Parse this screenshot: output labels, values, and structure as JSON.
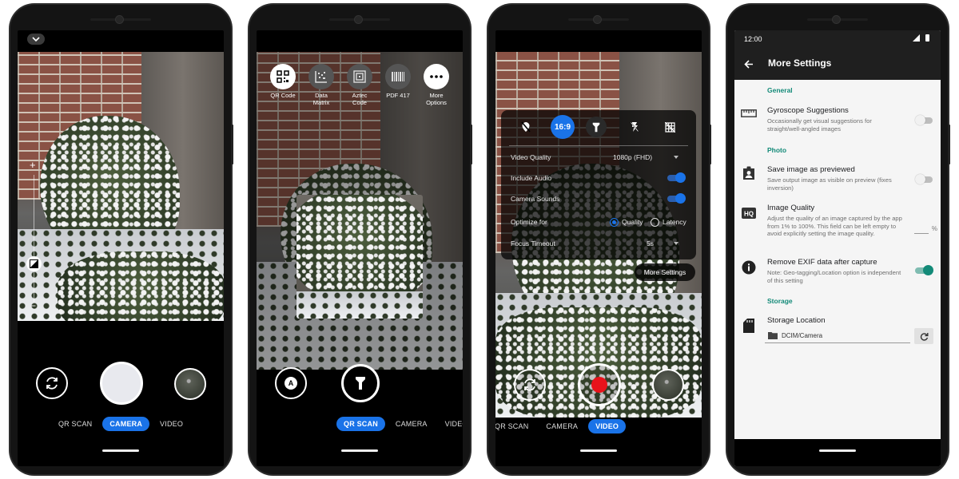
{
  "phone1": {
    "modes": [
      "QR SCAN",
      "CAMERA",
      "VIDEO"
    ],
    "active_mode": "CAMERA",
    "zoom_plus": "+",
    "zoom_minus": "−"
  },
  "phone2": {
    "barcode_types": [
      {
        "label": "QR Code"
      },
      {
        "label": "Data Matrix"
      },
      {
        "label": "Aztec Code"
      },
      {
        "label": "PDF 417"
      },
      {
        "label": "More Options"
      }
    ],
    "modes": [
      "QR SCAN",
      "CAMERA",
      "VIDEO"
    ],
    "auto_label": "A"
  },
  "phone3": {
    "aspect_ratio": "16:9",
    "settings": {
      "video_quality_label": "Video Quality",
      "video_quality_value": "1080p (FHD)",
      "include_audio_label": "Include Audio",
      "camera_sounds_label": "Camera Sounds",
      "optimize_label": "Optimize for",
      "optimize_opt1": "Quality",
      "optimize_opt2": "Latency",
      "focus_timeout_label": "Focus Timeout",
      "focus_timeout_value": "5s",
      "more_settings_button": "More Settings"
    },
    "modes": [
      "QR SCAN",
      "CAMERA",
      "VIDEO"
    ],
    "active_mode": "VIDEO"
  },
  "phone4": {
    "status_time": "12:00",
    "title": "More Settings",
    "sections": {
      "general": "General",
      "photo": "Photo",
      "storage": "Storage"
    },
    "items": {
      "gyro_title": "Gyroscope Suggestions",
      "gyro_sub": "Occasionally get visual suggestions for straight/well-angled images",
      "save_title": "Save image as previewed",
      "save_sub": "Save output image as visible on preview (fixes inversion)",
      "quality_title": "Image Quality",
      "quality_sub": "Adjust the quality of an image captured by the app from 1% to 100%. This field can be left empty to avoid explicitly setting the image quality.",
      "quality_unit": "%",
      "exif_title": "Remove EXIF data after capture",
      "exif_sub": "Note: Geo-tagging/Location option is independent of this setting",
      "storage_title": "Storage Location",
      "storage_path": "DCIM/Camera"
    }
  },
  "colors": {
    "accent_blue": "#1a73e8",
    "teal": "#138a78",
    "record_red": "#e8131b"
  }
}
